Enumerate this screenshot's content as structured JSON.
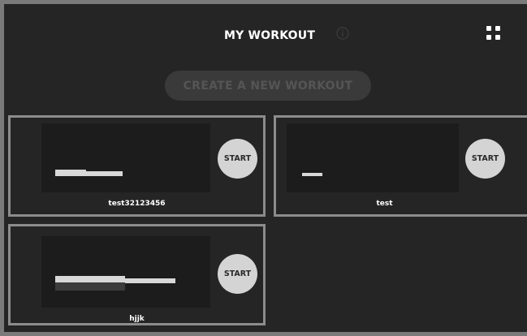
{
  "header": {
    "title": "MY WORKOUT",
    "info_icon": "info-icon",
    "view_toggle_icon": "grid-icon"
  },
  "create_button_label": "CREATE A NEW WORKOUT",
  "workouts": [
    {
      "name": "test32123456",
      "start_label": "START"
    },
    {
      "name": "test",
      "start_label": "START"
    },
    {
      "name": "hjjk",
      "start_label": "START"
    }
  ],
  "colors": {
    "background": "#252525",
    "card_border": "#8c8c8c",
    "preview_bg": "#1c1c1c",
    "start_button": "#d4d4d4",
    "create_button_bg": "#3a3a3a",
    "create_button_text": "#555555"
  }
}
